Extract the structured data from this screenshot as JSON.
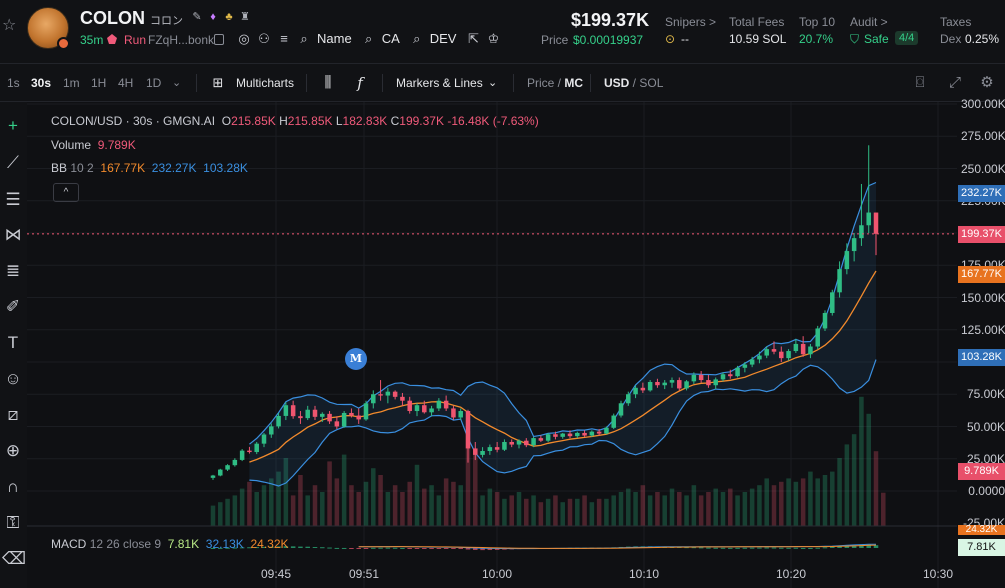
{
  "header": {
    "token_name": "COLON",
    "token_sub": "コロン",
    "age": "35m",
    "run_label": "Run",
    "address": "FZqH...bonk",
    "links": [
      {
        "icon": "globe-icon",
        "label": ""
      },
      {
        "icon": "people-icon",
        "label": ""
      },
      {
        "icon": "list-icon",
        "label": ""
      },
      {
        "icon": "search-icon",
        "label": "Name"
      },
      {
        "icon": "search-icon",
        "label": "CA"
      },
      {
        "icon": "search-icon",
        "label": "DEV"
      },
      {
        "icon": "share-icon",
        "label": ""
      },
      {
        "icon": "crown-icon",
        "label": ""
      }
    ],
    "market_cap": "$199.37K",
    "price_label": "Price",
    "price_value": "$0.00019937",
    "snipers_label": "Snipers >",
    "snipers_value": "--",
    "fees_label": "Total Fees",
    "fees_value": "10.59 SOL",
    "top10_label": "Top 10",
    "top10_value": "20.7%",
    "audit_label": "Audit >",
    "audit_value": "Safe",
    "audit_badge": "4/4",
    "taxes_label": "Taxes",
    "taxes_prefix": "Dex",
    "taxes_value": "0.25%"
  },
  "toolbar": {
    "intervals": [
      "1s",
      "30s",
      "1m",
      "1H",
      "4H",
      "1D"
    ],
    "active_interval": "30s",
    "multicharts": "Multicharts",
    "markers": "Markers & Lines",
    "price_mc": "Price / MC",
    "price_mc_a": "Price",
    "price_mc_b": "MC",
    "usd_sol_a": "USD",
    "usd_sol_b": "SOL"
  },
  "legend": {
    "symbol": "COLON/USD · 30s · GMGN.AI",
    "o_label": "O",
    "o_value": "215.85K",
    "h_label": "H",
    "h_value": "215.85K",
    "l_label": "L",
    "l_value": "182.83K",
    "c_label": "C",
    "c_value": "199.37K",
    "change": "-16.48K (-7.63%)",
    "volume_label": "Volume",
    "volume_value": "9.789K",
    "bb_label": "BB",
    "bb_params": "10 2",
    "bb_mid": "167.77K",
    "bb_upper": "232.27K",
    "bb_lower": "103.28K",
    "macd_label": "MACD",
    "macd_params": "12 26 close 9",
    "macd_val1": "7.81K",
    "macd_val2": "32.13K",
    "macd_val3": "24.32K",
    "marker_letter": "M"
  },
  "axis": {
    "y_labels": [
      "300.00K",
      "275.00K",
      "250.00K",
      "225.00K",
      "200.00K",
      "175.00K",
      "150.00K",
      "125.00K",
      "100.00K",
      "75.00K",
      "50.00K",
      "25.00K",
      "0.0000",
      "-25.00K"
    ],
    "tags": {
      "upper": "232.27K",
      "price": "199.37K",
      "mid": "167.77K",
      "lower": "103.28K",
      "volume": "9.789K",
      "macd_top": "24.32K",
      "macd": "7.81K"
    },
    "time_labels": [
      "09:45",
      "09:51",
      "10:00",
      "10:10",
      "10:20",
      "10:30"
    ]
  },
  "colors": {
    "up": "#2fbd85",
    "down": "#f0556f",
    "bb_upper": "#3a8fe0",
    "bb_mid": "#f28a2c",
    "accent_green": "#35d08a"
  },
  "chart_data": {
    "type": "candlestick",
    "interval": "30s",
    "series_candles": [
      {
        "o": 10.2,
        "h": 12.5,
        "l": 8.6,
        "c": 12.0
      },
      {
        "o": 12.0,
        "h": 17.2,
        "l": 11.4,
        "c": 16.6
      },
      {
        "o": 16.6,
        "h": 20.8,
        "l": 15.5,
        "c": 20.0
      },
      {
        "o": 20.0,
        "h": 25.4,
        "l": 18.9,
        "c": 24.1
      },
      {
        "o": 24.1,
        "h": 32.5,
        "l": 23.2,
        "c": 31.3
      },
      {
        "o": 31.3,
        "h": 34.2,
        "l": 29.0,
        "c": 30.2
      },
      {
        "o": 30.2,
        "h": 38.0,
        "l": 28.6,
        "c": 36.7
      },
      {
        "o": 36.7,
        "h": 45.0,
        "l": 34.0,
        "c": 43.8
      },
      {
        "o": 43.8,
        "h": 52.4,
        "l": 41.2,
        "c": 50.1
      },
      {
        "o": 50.1,
        "h": 60.5,
        "l": 48.5,
        "c": 58.2
      },
      {
        "o": 58.2,
        "h": 68.9,
        "l": 55.0,
        "c": 66.5
      },
      {
        "o": 66.5,
        "h": 70.0,
        "l": 56.0,
        "c": 58.0
      },
      {
        "o": 58.0,
        "h": 62.0,
        "l": 52.0,
        "c": 56.5
      },
      {
        "o": 56.5,
        "h": 66.0,
        "l": 55.0,
        "c": 63.0
      },
      {
        "o": 63.0,
        "h": 66.0,
        "l": 55.0,
        "c": 57.5
      },
      {
        "o": 57.5,
        "h": 61.0,
        "l": 53.5,
        "c": 59.8
      },
      {
        "o": 59.8,
        "h": 62.0,
        "l": 52.0,
        "c": 54.0
      },
      {
        "o": 54.0,
        "h": 58.0,
        "l": 48.0,
        "c": 50.0
      },
      {
        "o": 50.0,
        "h": 62.0,
        "l": 49.0,
        "c": 60.5
      },
      {
        "o": 60.5,
        "h": 64.0,
        "l": 57.0,
        "c": 58.5
      },
      {
        "o": 58.5,
        "h": 64.0,
        "l": 52.0,
        "c": 55.5
      },
      {
        "o": 55.5,
        "h": 70.0,
        "l": 54.5,
        "c": 68.0
      },
      {
        "o": 68.0,
        "h": 78.0,
        "l": 64.0,
        "c": 75.0
      },
      {
        "o": 75.0,
        "h": 86.0,
        "l": 70.0,
        "c": 74.0
      },
      {
        "o": 74.0,
        "h": 80.0,
        "l": 68.0,
        "c": 77.0
      },
      {
        "o": 77.0,
        "h": 78.0,
        "l": 71.0,
        "c": 73.0
      },
      {
        "o": 73.0,
        "h": 76.0,
        "l": 66.0,
        "c": 70.0
      },
      {
        "o": 70.0,
        "h": 73.0,
        "l": 60.0,
        "c": 62.0
      },
      {
        "o": 62.0,
        "h": 68.0,
        "l": 58.0,
        "c": 66.5
      },
      {
        "o": 66.5,
        "h": 70.0,
        "l": 60.0,
        "c": 61.0
      },
      {
        "o": 61.0,
        "h": 66.0,
        "l": 58.0,
        "c": 64.0
      },
      {
        "o": 64.0,
        "h": 72.0,
        "l": 62.0,
        "c": 70.0
      },
      {
        "o": 70.0,
        "h": 74.0,
        "l": 62.0,
        "c": 64.0
      },
      {
        "o": 64.0,
        "h": 66.0,
        "l": 55.0,
        "c": 57.0
      },
      {
        "o": 57.0,
        "h": 64.0,
        "l": 55.0,
        "c": 62.0
      },
      {
        "o": 62.0,
        "h": 63.0,
        "l": 22.0,
        "c": 33.0
      },
      {
        "o": 33.0,
        "h": 38.0,
        "l": 24.0,
        "c": 28.0
      },
      {
        "o": 28.0,
        "h": 34.0,
        "l": 26.0,
        "c": 31.0
      },
      {
        "o": 31.0,
        "h": 36.0,
        "l": 28.0,
        "c": 34.0
      },
      {
        "o": 34.0,
        "h": 38.0,
        "l": 30.0,
        "c": 32.0
      },
      {
        "o": 32.0,
        "h": 40.0,
        "l": 31.0,
        "c": 38.0
      },
      {
        "o": 38.0,
        "h": 40.0,
        "l": 34.0,
        "c": 36.0
      },
      {
        "o": 36.0,
        "h": 40.0,
        "l": 33.0,
        "c": 39.0
      },
      {
        "o": 39.0,
        "h": 41.0,
        "l": 34.0,
        "c": 35.5
      },
      {
        "o": 35.5,
        "h": 42.0,
        "l": 34.0,
        "c": 41.0
      },
      {
        "o": 41.0,
        "h": 43.0,
        "l": 38.0,
        "c": 39.0
      },
      {
        "o": 39.0,
        "h": 45.0,
        "l": 38.0,
        "c": 44.0
      },
      {
        "o": 44.0,
        "h": 46.0,
        "l": 40.0,
        "c": 42.0
      },
      {
        "o": 42.0,
        "h": 45.0,
        "l": 40.5,
        "c": 44.5
      },
      {
        "o": 44.5,
        "h": 47.0,
        "l": 41.0,
        "c": 42.5
      },
      {
        "o": 42.5,
        "h": 46.0,
        "l": 41.0,
        "c": 45.0
      },
      {
        "o": 45.0,
        "h": 47.0,
        "l": 42.0,
        "c": 43.0
      },
      {
        "o": 43.0,
        "h": 47.0,
        "l": 42.0,
        "c": 46.0
      },
      {
        "o": 46.0,
        "h": 48.0,
        "l": 43.0,
        "c": 44.5
      },
      {
        "o": 44.5,
        "h": 50.0,
        "l": 44.0,
        "c": 49.0
      },
      {
        "o": 49.0,
        "h": 60.0,
        "l": 48.0,
        "c": 58.5
      },
      {
        "o": 58.5,
        "h": 70.0,
        "l": 57.0,
        "c": 68.0
      },
      {
        "o": 68.0,
        "h": 77.0,
        "l": 66.0,
        "c": 75.0
      },
      {
        "o": 75.0,
        "h": 82.0,
        "l": 72.0,
        "c": 80.0
      },
      {
        "o": 80.0,
        "h": 84.0,
        "l": 76.0,
        "c": 78.0
      },
      {
        "o": 78.0,
        "h": 86.0,
        "l": 77.0,
        "c": 84.5
      },
      {
        "o": 84.5,
        "h": 87.0,
        "l": 80.0,
        "c": 82.0
      },
      {
        "o": 82.0,
        "h": 86.0,
        "l": 79.0,
        "c": 84.0
      },
      {
        "o": 84.0,
        "h": 88.0,
        "l": 80.0,
        "c": 86.0
      },
      {
        "o": 86.0,
        "h": 88.0,
        "l": 78.0,
        "c": 79.5
      },
      {
        "o": 79.5,
        "h": 86.0,
        "l": 78.0,
        "c": 85.0
      },
      {
        "o": 85.0,
        "h": 92.0,
        "l": 83.0,
        "c": 90.0
      },
      {
        "o": 90.0,
        "h": 93.0,
        "l": 84.0,
        "c": 86.0
      },
      {
        "o": 86.0,
        "h": 90.0,
        "l": 80.0,
        "c": 82.0
      },
      {
        "o": 82.0,
        "h": 88.0,
        "l": 79.0,
        "c": 86.5
      },
      {
        "o": 86.5,
        "h": 92.0,
        "l": 85.0,
        "c": 90.5
      },
      {
        "o": 90.5,
        "h": 94.0,
        "l": 87.0,
        "c": 89.0
      },
      {
        "o": 89.0,
        "h": 97.0,
        "l": 88.0,
        "c": 95.5
      },
      {
        "o": 95.5,
        "h": 100.0,
        "l": 92.0,
        "c": 98.0
      },
      {
        "o": 98.0,
        "h": 104.0,
        "l": 96.0,
        "c": 102.0
      },
      {
        "o": 102.0,
        "h": 108.0,
        "l": 99.0,
        "c": 105.0
      },
      {
        "o": 105.0,
        "h": 112.0,
        "l": 103.0,
        "c": 110.0
      },
      {
        "o": 110.0,
        "h": 116.0,
        "l": 106.0,
        "c": 108.0
      },
      {
        "o": 108.0,
        "h": 112.0,
        "l": 100.0,
        "c": 103.0
      },
      {
        "o": 103.0,
        "h": 110.0,
        "l": 101.0,
        "c": 108.5
      },
      {
        "o": 108.5,
        "h": 118.0,
        "l": 107.0,
        "c": 114.0
      },
      {
        "o": 114.0,
        "h": 120.0,
        "l": 104.0,
        "c": 106.0
      },
      {
        "o": 106.0,
        "h": 114.0,
        "l": 103.0,
        "c": 112.0
      },
      {
        "o": 112.0,
        "h": 128.0,
        "l": 110.0,
        "c": 126.0
      },
      {
        "o": 126.0,
        "h": 140.0,
        "l": 124.0,
        "c": 138.0
      },
      {
        "o": 138.0,
        "h": 156.0,
        "l": 136.0,
        "c": 154.0
      },
      {
        "o": 154.0,
        "h": 178.0,
        "l": 150.0,
        "c": 172.0
      },
      {
        "o": 172.0,
        "h": 192.0,
        "l": 168.0,
        "c": 186.0
      },
      {
        "o": 186.0,
        "h": 200.0,
        "l": 178.0,
        "c": 196.0
      },
      {
        "o": 196.0,
        "h": 238.0,
        "l": 190.0,
        "c": 206.0
      },
      {
        "o": 206.0,
        "h": 268.0,
        "l": 200.0,
        "c": 215.85
      },
      {
        "o": 215.85,
        "h": 215.85,
        "l": 182.83,
        "c": 199.37
      }
    ],
    "volume": [
      6,
      7,
      8,
      9,
      11,
      13,
      10,
      12,
      14,
      16,
      20,
      9,
      15,
      9,
      12,
      10,
      19,
      14,
      21,
      12,
      10,
      13,
      17,
      15,
      10,
      12,
      10,
      13,
      18,
      11,
      12,
      9,
      14,
      13,
      12,
      28,
      22,
      9,
      11,
      10,
      8,
      9,
      10,
      8,
      9,
      7,
      8,
      9,
      7,
      8,
      8,
      9,
      7,
      8,
      8,
      9,
      10,
      11,
      10,
      12,
      9,
      10,
      9,
      11,
      10,
      9,
      12,
      9,
      10,
      11,
      10,
      11,
      9,
      10,
      11,
      12,
      14,
      12,
      13,
      14,
      13,
      14,
      16,
      14,
      15,
      16,
      20,
      24,
      27,
      38,
      33,
      22,
      9.789
    ],
    "bb_upper": [],
    "ylim": [
      -25,
      300
    ],
    "y_unit": "K USD (market cap)"
  }
}
